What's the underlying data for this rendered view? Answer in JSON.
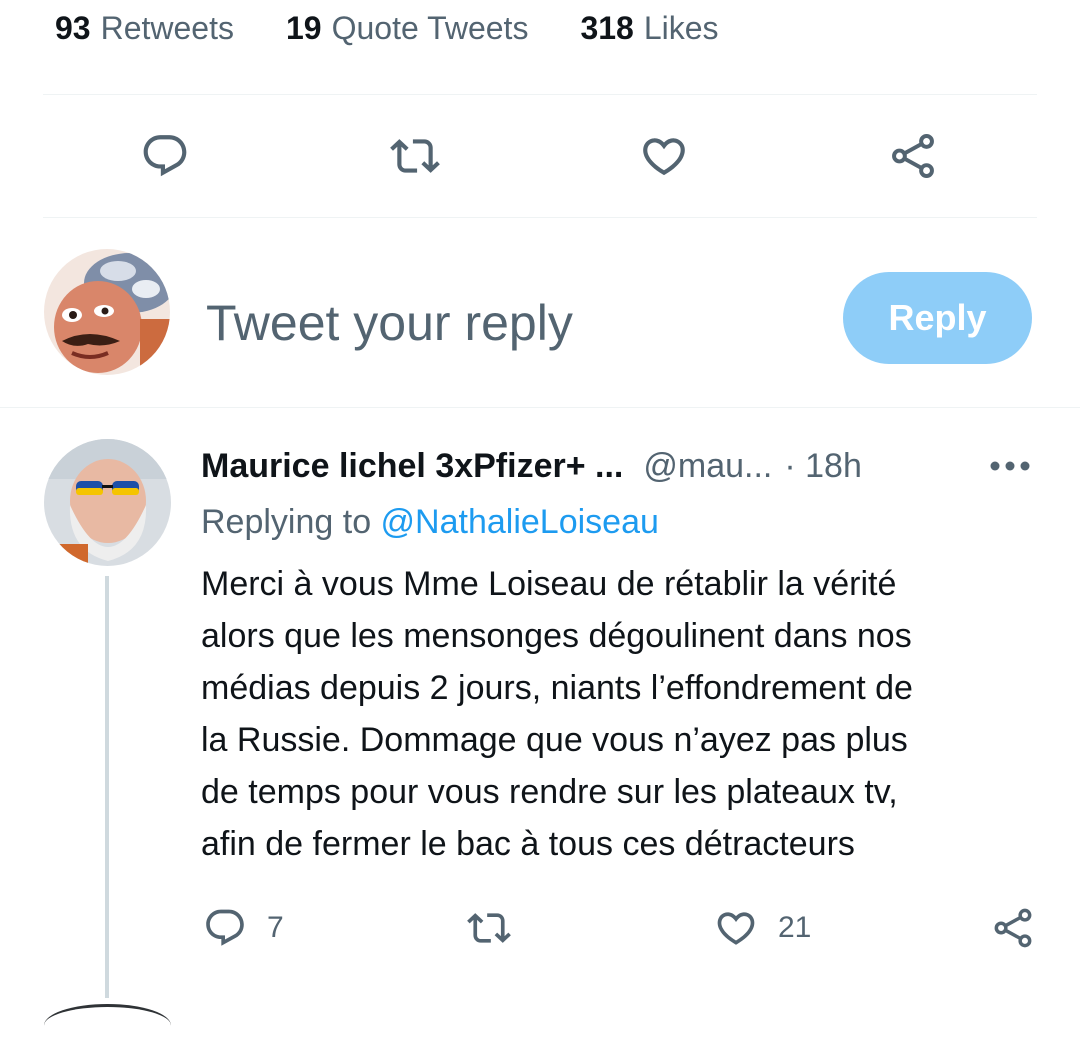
{
  "stats": {
    "retweets": {
      "count": "93",
      "label": "Retweets"
    },
    "quotes": {
      "count": "19",
      "label": "Quote Tweets"
    },
    "likes": {
      "count": "318",
      "label": "Likes"
    }
  },
  "main_actions": [
    "reply-icon",
    "retweet-icon",
    "like-icon",
    "share-icon"
  ],
  "composer": {
    "placeholder": "Tweet your reply",
    "reply_label": "Reply",
    "reply_button_color": "#8ecdf8"
  },
  "reply_tweet": {
    "author_name": "Maurice lichel 3xPfizer+ ...",
    "handle": "@mau...",
    "time": "· 18h",
    "replying_prefix": "Replying to ",
    "replying_to": "@NathalieLoiseau",
    "text": "Merci à vous Mme Loiseau de rétablir la vérité\nalors que les mensonges dégoulinent dans nos\nmédias depuis 2 jours, niants l’effondrement de\nla  Russie. Dommage que vous n’ayez pas plus\nde temps pour vous rendre sur les plateaux tv,\nafin de fermer le bac à tous ces détracteurs",
    "reply_count": "7",
    "retweet_count": "",
    "like_count": "21"
  },
  "colors": {
    "accent": "#1d9bf0",
    "text_primary": "#0f1419",
    "text_secondary": "#536471",
    "divider": "#eff3f4"
  }
}
